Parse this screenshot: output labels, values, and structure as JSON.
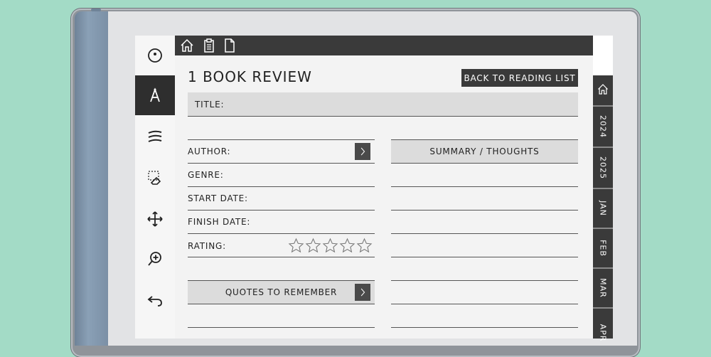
{
  "topbar": {
    "icons": [
      "home-icon",
      "clipboard-icon",
      "document-icon"
    ]
  },
  "toolbar": {
    "tools": [
      "circle-dot-icon",
      "pen-tool-icon",
      "menu-lines-icon",
      "eraser-icon",
      "move-icon",
      "zoom-in-icon",
      "undo-icon"
    ],
    "active": "pen-tool-icon"
  },
  "page": {
    "title": "1 BOOK REVIEW",
    "back_button": "BACK TO READING LIST",
    "title_label": "TITLE:",
    "fields": [
      {
        "label": "AUTHOR:"
      },
      {
        "label": "GENRE:"
      },
      {
        "label": "START DATE:"
      },
      {
        "label": "FINISH DATE:"
      },
      {
        "label": "RATING:"
      }
    ],
    "rating": {
      "value": 0,
      "max": 5
    },
    "summary_header": "SUMMARY / THOUGHTS",
    "quotes_header": "QUOTES TO REMEMBER"
  },
  "tabs": {
    "home_icon": "home-icon",
    "items": [
      "2024",
      "2025",
      "JAN",
      "FEB",
      "MAR",
      "APR"
    ]
  },
  "colors": {
    "background": "#a3dbc6",
    "dark": "#3a3a3a",
    "shaded": "#dcdcdc"
  }
}
